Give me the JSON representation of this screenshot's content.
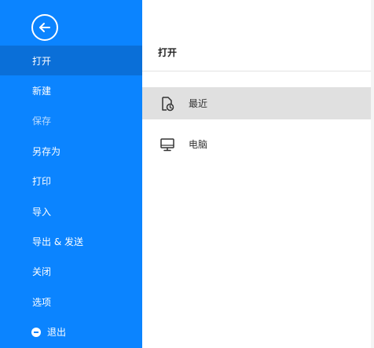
{
  "sidebar": {
    "back_icon": "arrow-left-circle-icon",
    "items": [
      {
        "label": "打开",
        "state": "active"
      },
      {
        "label": "新建",
        "state": "normal"
      },
      {
        "label": "保存",
        "state": "disabled"
      },
      {
        "label": "另存为",
        "state": "normal"
      },
      {
        "label": "打印",
        "state": "normal"
      },
      {
        "label": "导入",
        "state": "normal"
      },
      {
        "label": "导出 & 发送",
        "state": "normal"
      },
      {
        "label": "关闭",
        "state": "normal"
      },
      {
        "label": "选项",
        "state": "normal"
      },
      {
        "label": "退出",
        "state": "normal",
        "icon": "minus-circle-icon"
      }
    ]
  },
  "main": {
    "title": "打开",
    "options": [
      {
        "label": "最近",
        "icon": "recent-file-clock-icon",
        "selected": true
      },
      {
        "label": "电脑",
        "icon": "monitor-icon",
        "selected": false
      }
    ]
  },
  "colors": {
    "sidebar_bg": "#0b84ff",
    "sidebar_active": "#0a6fd8",
    "selected_option_bg": "#e0e0e0"
  }
}
